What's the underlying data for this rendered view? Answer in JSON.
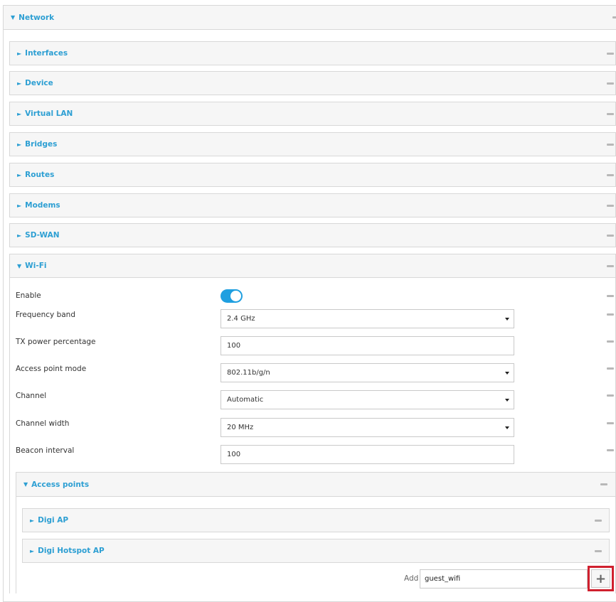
{
  "network": {
    "title": "Network"
  },
  "sections": [
    {
      "label": "Interfaces"
    },
    {
      "label": "Device"
    },
    {
      "label": "Virtual LAN"
    },
    {
      "label": "Bridges"
    },
    {
      "label": "Routes"
    },
    {
      "label": "Modems"
    },
    {
      "label": "SD-WAN"
    }
  ],
  "wifi": {
    "title": "Wi-Fi",
    "enable_label": "Enable",
    "enabled": true,
    "frequency_band": {
      "label": "Frequency band",
      "value": "2.4 GHz"
    },
    "tx_power": {
      "label": "TX power percentage",
      "value": "100"
    },
    "access_point_mode": {
      "label": "Access point mode",
      "value": "802.11b/g/n"
    },
    "channel": {
      "label": "Channel",
      "value": "Automatic"
    },
    "channel_width": {
      "label": "Channel width",
      "value": "20 MHz"
    },
    "beacon_interval": {
      "label": "Beacon interval",
      "value": "100"
    }
  },
  "access_points": {
    "title": "Access points",
    "items": [
      {
        "label": "Digi AP"
      },
      {
        "label": "Digi Hotspot AP"
      }
    ],
    "add_label": "Add",
    "add_value": "guest_wifi"
  },
  "colors": {
    "accent": "#2d9fd3",
    "toggle": "#1f9fe0",
    "highlight": "#d0202e"
  }
}
